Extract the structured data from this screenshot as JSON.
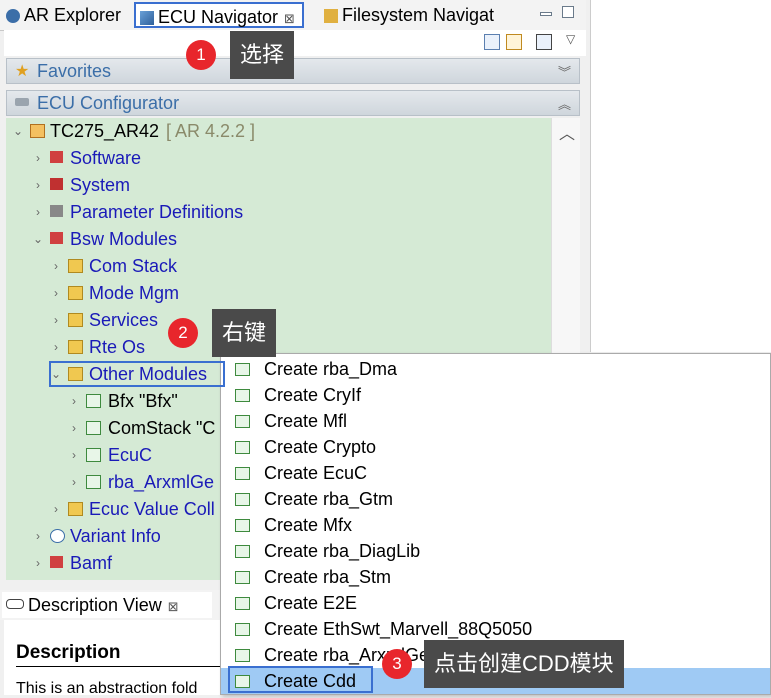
{
  "tabs": [
    {
      "label": "AR Explorer"
    },
    {
      "label": "ECU Navigator",
      "close": "⊠"
    },
    {
      "label": "Filesystem Navigat"
    }
  ],
  "sections": {
    "favorites": "Favorites",
    "ecu_configurator": "ECU Configurator"
  },
  "tree": {
    "root": {
      "label": "TC275_AR42",
      "version": "[ AR 4.2.2 ]"
    },
    "items": [
      {
        "label": "Software"
      },
      {
        "label": "System"
      },
      {
        "label": "Parameter Definitions"
      },
      {
        "label": "Bsw Modules"
      },
      {
        "label": "Com Stack"
      },
      {
        "label": "Mode Mgm"
      },
      {
        "label": "Services"
      },
      {
        "label": "Rte Os"
      },
      {
        "label": "Other Modules"
      },
      {
        "label": "Bfx \"Bfx\""
      },
      {
        "label": "ComStack \"C"
      },
      {
        "label": "EcuC"
      },
      {
        "label": "rba_ArxmlGe"
      },
      {
        "label": "Ecuc Value Coll"
      },
      {
        "label": "Variant Info"
      },
      {
        "label": "Bamf"
      }
    ]
  },
  "description_view": {
    "tab_label": "Description View",
    "close": "⊠",
    "heading": "Description",
    "body": "This is an abstraction fold"
  },
  "context_menu": {
    "items": [
      "Create rba_Dma",
      "Create CryIf",
      "Create Mfl",
      "Create Crypto",
      "Create EcuC",
      "Create rba_Gtm",
      "Create Mfx",
      "Create rba_DiagLib",
      "Create rba_Stm",
      "Create E2E",
      "Create EthSwt_Marvell_88Q5050",
      "Create rba_ArxmlGen",
      "Create Cdd"
    ],
    "highlighted_index": 12
  },
  "annotations": [
    {
      "number": "1",
      "text": "选择"
    },
    {
      "number": "2",
      "text": "右键"
    },
    {
      "number": "3",
      "text": "点击创建CDD模块"
    }
  ],
  "colors": {
    "accent": "#3a6fd0",
    "badge": "#e8262c",
    "tree_bg": "#d5ead5",
    "menu_highlight": "#9fcaf4"
  }
}
